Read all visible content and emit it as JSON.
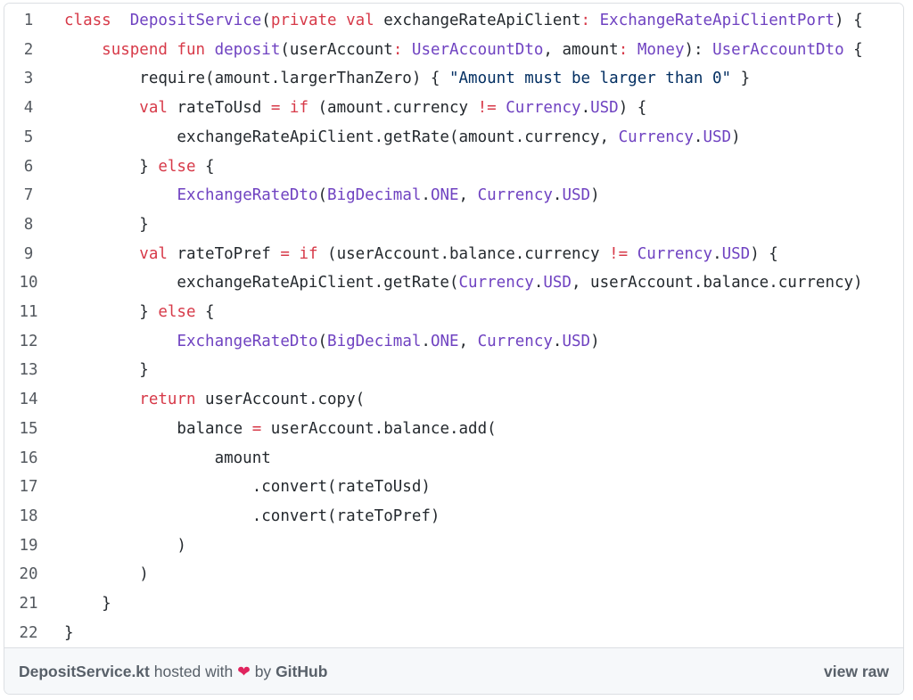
{
  "code": {
    "language": "kotlin",
    "lines": [
      {
        "n": "1",
        "tokens": [
          [
            "kw",
            "class"
          ],
          [
            "",
            "  "
          ],
          [
            "ty",
            "DepositService"
          ],
          [
            "",
            "("
          ],
          [
            "kw",
            "private val"
          ],
          [
            "",
            " exchangeRateApiClient"
          ],
          [
            "kw",
            ":"
          ],
          [
            "",
            " "
          ],
          [
            "ty",
            "ExchangeRateApiClientPort"
          ],
          [
            "",
            ") {"
          ]
        ]
      },
      {
        "n": "2",
        "tokens": [
          [
            "",
            "    "
          ],
          [
            "kw",
            "suspend fun"
          ],
          [
            "",
            " "
          ],
          [
            "ty",
            "deposit"
          ],
          [
            "",
            "(userAccount"
          ],
          [
            "kw",
            ":"
          ],
          [
            "",
            " "
          ],
          [
            "ty",
            "UserAccountDto"
          ],
          [
            "",
            ", amount"
          ],
          [
            "kw",
            ":"
          ],
          [
            "",
            " "
          ],
          [
            "ty",
            "Money"
          ],
          [
            "",
            "): "
          ],
          [
            "ty",
            "UserAccountDto"
          ],
          [
            "",
            " {"
          ]
        ]
      },
      {
        "n": "3",
        "tokens": [
          [
            "",
            "        require(amount.largerThanZero) { "
          ],
          [
            "str",
            "\"Amount must be larger than 0\""
          ],
          [
            "",
            " }"
          ]
        ]
      },
      {
        "n": "4",
        "tokens": [
          [
            "",
            "        "
          ],
          [
            "kw",
            "val"
          ],
          [
            "",
            " rateToUsd "
          ],
          [
            "kw",
            "="
          ],
          [
            "",
            " "
          ],
          [
            "kw",
            "if"
          ],
          [
            "",
            " (amount.currency "
          ],
          [
            "kw",
            "!="
          ],
          [
            "",
            " "
          ],
          [
            "ty",
            "Currency"
          ],
          [
            "",
            "."
          ],
          [
            "ty",
            "USD"
          ],
          [
            "",
            ") {"
          ]
        ]
      },
      {
        "n": "5",
        "tokens": [
          [
            "",
            "            exchangeRateApiClient.getRate(amount.currency, "
          ],
          [
            "ty",
            "Currency"
          ],
          [
            "",
            "."
          ],
          [
            "ty",
            "USD"
          ],
          [
            "",
            ")"
          ]
        ]
      },
      {
        "n": "6",
        "tokens": [
          [
            "",
            "        } "
          ],
          [
            "kw",
            "else"
          ],
          [
            "",
            " {"
          ]
        ]
      },
      {
        "n": "7",
        "tokens": [
          [
            "",
            "            "
          ],
          [
            "ty",
            "ExchangeRateDto"
          ],
          [
            "",
            "("
          ],
          [
            "ty",
            "BigDecimal"
          ],
          [
            "",
            "."
          ],
          [
            "ty",
            "ONE"
          ],
          [
            "",
            ", "
          ],
          [
            "ty",
            "Currency"
          ],
          [
            "",
            "."
          ],
          [
            "ty",
            "USD"
          ],
          [
            "",
            ")"
          ]
        ]
      },
      {
        "n": "8",
        "tokens": [
          [
            "",
            "        }"
          ]
        ]
      },
      {
        "n": "9",
        "tokens": [
          [
            "",
            "        "
          ],
          [
            "kw",
            "val"
          ],
          [
            "",
            " rateToPref "
          ],
          [
            "kw",
            "="
          ],
          [
            "",
            " "
          ],
          [
            "kw",
            "if"
          ],
          [
            "",
            " (userAccount.balance.currency "
          ],
          [
            "kw",
            "!="
          ],
          [
            "",
            " "
          ],
          [
            "ty",
            "Currency"
          ],
          [
            "",
            "."
          ],
          [
            "ty",
            "USD"
          ],
          [
            "",
            ") {"
          ]
        ]
      },
      {
        "n": "10",
        "tokens": [
          [
            "",
            "            exchangeRateApiClient.getRate("
          ],
          [
            "ty",
            "Currency"
          ],
          [
            "",
            "."
          ],
          [
            "ty",
            "USD"
          ],
          [
            "",
            ", userAccount.balance.currency)"
          ]
        ]
      },
      {
        "n": "11",
        "tokens": [
          [
            "",
            "        } "
          ],
          [
            "kw",
            "else"
          ],
          [
            "",
            " {"
          ]
        ]
      },
      {
        "n": "12",
        "tokens": [
          [
            "",
            "            "
          ],
          [
            "ty",
            "ExchangeRateDto"
          ],
          [
            "",
            "("
          ],
          [
            "ty",
            "BigDecimal"
          ],
          [
            "",
            "."
          ],
          [
            "ty",
            "ONE"
          ],
          [
            "",
            ", "
          ],
          [
            "ty",
            "Currency"
          ],
          [
            "",
            "."
          ],
          [
            "ty",
            "USD"
          ],
          [
            "",
            ")"
          ]
        ]
      },
      {
        "n": "13",
        "tokens": [
          [
            "",
            "        }"
          ]
        ]
      },
      {
        "n": "14",
        "tokens": [
          [
            "",
            "        "
          ],
          [
            "kw",
            "return"
          ],
          [
            "",
            " userAccount.copy("
          ]
        ]
      },
      {
        "n": "15",
        "tokens": [
          [
            "",
            "            balance "
          ],
          [
            "kw",
            "="
          ],
          [
            "",
            " userAccount.balance.add("
          ]
        ]
      },
      {
        "n": "16",
        "tokens": [
          [
            "",
            "                amount"
          ]
        ]
      },
      {
        "n": "17",
        "tokens": [
          [
            "",
            "                    .convert(rateToUsd)"
          ]
        ]
      },
      {
        "n": "18",
        "tokens": [
          [
            "",
            "                    .convert(rateToPref)"
          ]
        ]
      },
      {
        "n": "19",
        "tokens": [
          [
            "",
            "            )"
          ]
        ]
      },
      {
        "n": "20",
        "tokens": [
          [
            "",
            "        )"
          ]
        ]
      },
      {
        "n": "21",
        "tokens": [
          [
            "",
            "    }"
          ]
        ]
      },
      {
        "n": "22",
        "tokens": [
          [
            "",
            "}"
          ]
        ]
      }
    ]
  },
  "footer": {
    "file_name": "DepositService.kt",
    "hosted_with": "hosted with",
    "heart": "❤",
    "by": "by",
    "github": "GitHub",
    "view_raw": "view raw"
  },
  "colors": {
    "keyword": "#d73a49",
    "type": "#6f42c1",
    "string": "#032f62",
    "text": "#24292e",
    "line_number": "#555a60",
    "footer_bg": "#f6f8fa",
    "heart": "#e0245e"
  }
}
